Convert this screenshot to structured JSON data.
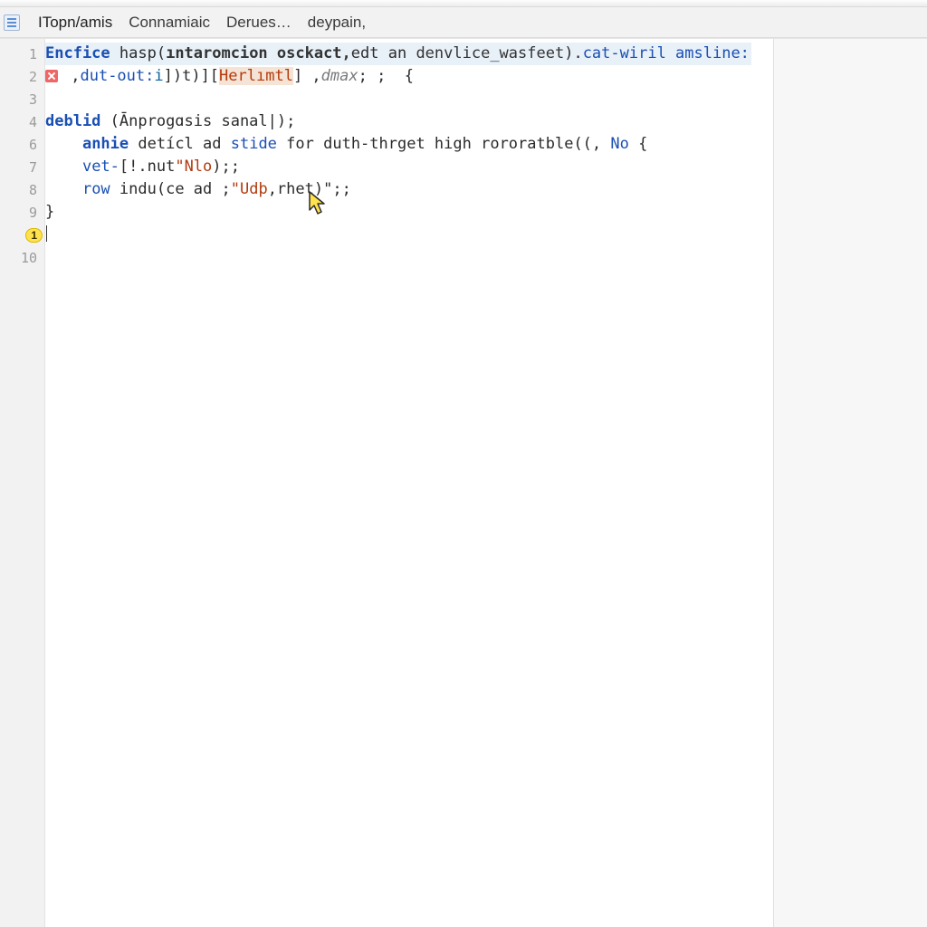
{
  "tabs": {
    "file": "ITopn/amis",
    "t2": "Connamiaic",
    "t3": "Derues…",
    "t4": "deypain,"
  },
  "gutter": {
    "l1": "1",
    "l2": "2",
    "l3": "3",
    "l4": "4",
    "l5": "6",
    "l6": "7",
    "l7": "8",
    "l8": "9",
    "l9": "9",
    "l10": "10",
    "badge9": "1"
  },
  "code": {
    "l1a": "Encfice",
    "l1b": " hasp(",
    "l1c": "ıntaromcion osckact,",
    "l1d": "edt an ",
    "l1e": "denvlice_wasfeet",
    "l1f": ").",
    "l1g": "cat‑wiril amsline:",
    "l2a": " ,",
    "l2b": "dut-out:",
    "l2c": "i",
    "l2d": "])t)][",
    "l2e": "Herlımtl",
    "l2f": "] ,",
    "l2g": "dmax",
    "l2h": "; ;  {",
    "l4a": "deblid",
    "l4b": " (Ānprogɑsis sanal|);",
    "l6a": "anhie",
    "l6b": " detícl ad ",
    "l6c": "stide",
    "l6d": " for ",
    "l6e": "duth-thrget high rororatble((, ",
    "l6f": "No",
    "l6g": " {",
    "l7a": "vet-",
    "l7b": "[!.nut",
    "l7c": "\"Nlo",
    "l7d": ");;",
    "l8a": "row",
    "l8b": " indu(ce ad ;",
    "l8c": "\"Udþ",
    "l8d": ",rhet)\";;",
    "l9a": "}"
  }
}
